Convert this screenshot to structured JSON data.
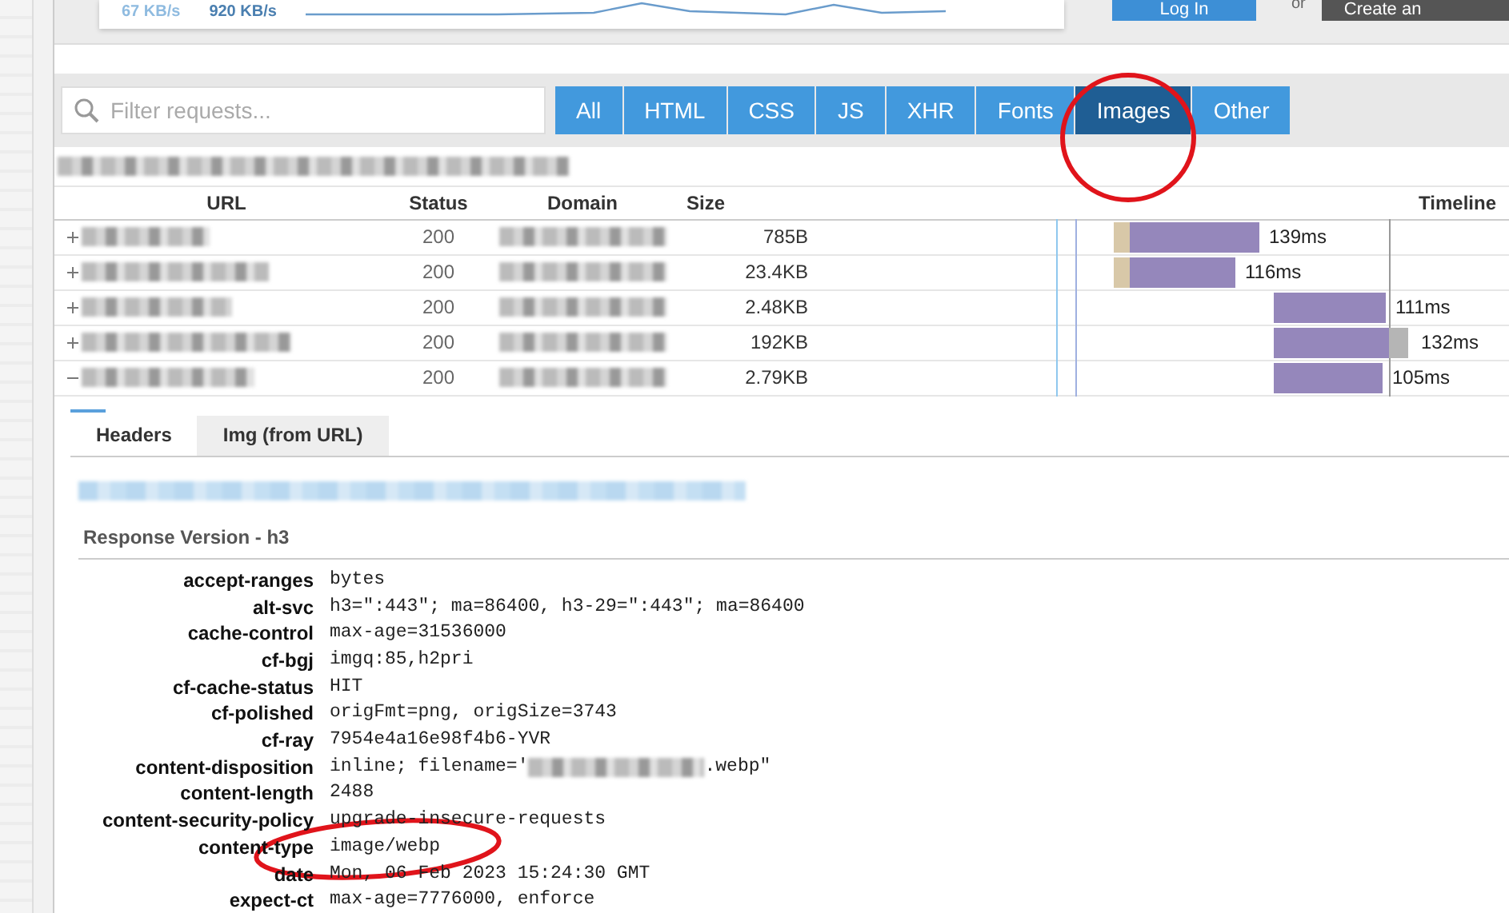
{
  "top_bar": {
    "stats": [
      "67 KB/s",
      "920 KB/s"
    ],
    "login_button": "Log In",
    "separator": "or",
    "create_button": "Create an"
  },
  "filter": {
    "placeholder": "Filter requests..."
  },
  "type_tabs": [
    {
      "label": "All",
      "selected": false
    },
    {
      "label": "HTML",
      "selected": false
    },
    {
      "label": "CSS",
      "selected": false
    },
    {
      "label": "JS",
      "selected": false
    },
    {
      "label": "XHR",
      "selected": false
    },
    {
      "label": "Fonts",
      "selected": false
    },
    {
      "label": "Images",
      "selected": true
    },
    {
      "label": "Other",
      "selected": false
    }
  ],
  "table": {
    "columns": [
      "URL",
      "Status",
      "Domain",
      "Size",
      "Timeline"
    ],
    "rows": [
      {
        "status": "200",
        "size": "785B",
        "time": "139ms",
        "expanded": false,
        "blocked": true,
        "trailing": false
      },
      {
        "status": "200",
        "size": "23.4KB",
        "time": "116ms",
        "expanded": false,
        "blocked": true,
        "trailing": false
      },
      {
        "status": "200",
        "size": "2.48KB",
        "time": "111ms",
        "expanded": false,
        "blocked": false,
        "trailing": false
      },
      {
        "status": "200",
        "size": "192KB",
        "time": "132ms",
        "expanded": false,
        "blocked": false,
        "trailing": true
      },
      {
        "status": "200",
        "size": "2.79KB",
        "time": "105ms",
        "expanded": true,
        "blocked": false,
        "trailing": false
      }
    ]
  },
  "detail_tabs": [
    {
      "label": "Headers",
      "selected": true
    },
    {
      "label": "Img (from URL)",
      "selected": false
    }
  ],
  "response": {
    "title": "Response Version - h3",
    "headers": [
      {
        "name": "accept-ranges",
        "value": "bytes"
      },
      {
        "name": "alt-svc",
        "value": "h3=\":443\"; ma=86400, h3-29=\":443\"; ma=86400"
      },
      {
        "name": "cache-control",
        "value": "max-age=31536000"
      },
      {
        "name": "cf-bgj",
        "value": "imgq:85,h2pri"
      },
      {
        "name": "cf-cache-status",
        "value": "HIT"
      },
      {
        "name": "cf-polished",
        "value": "origFmt=png, origSize=3743"
      },
      {
        "name": "cf-ray",
        "value": "7954e4a16e98f4b6-YVR"
      },
      {
        "name": "content-disposition",
        "value": "inline; filename='",
        "suffix": ".webp\""
      },
      {
        "name": "content-length",
        "value": "2488"
      },
      {
        "name": "content-security-policy",
        "value": "upgrade-insecure-requests"
      },
      {
        "name": "content-type",
        "value": "image/webp"
      },
      {
        "name": "date",
        "value": "Mon, 06 Feb 2023 15:24:30 GMT"
      },
      {
        "name": "expect-ct",
        "value": "max-age=7776000, enforce"
      }
    ]
  }
}
